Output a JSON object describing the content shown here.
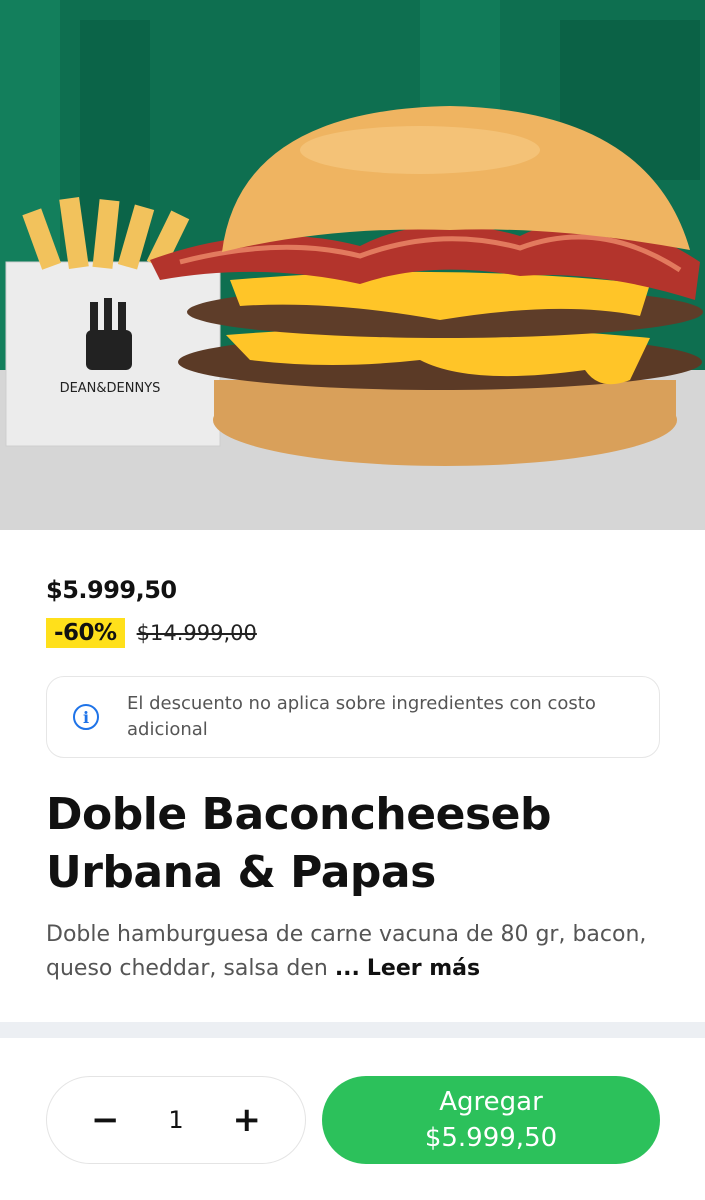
{
  "hero": {
    "brand_text": "DEAN&DENNYS",
    "image_description": "burger-and-fries-photo"
  },
  "product": {
    "price": "$5.999,50",
    "discount": "-60%",
    "old_price": "$14.999,00",
    "notice": "El descuento no aplica sobre ingredientes con costo adicional",
    "title": "Doble Baconcheeseb Urbana & Papas",
    "description": "Doble hamburguesa de carne vacuna de 80 gr, bacon, queso cheddar, salsa den",
    "ellipsis": "...",
    "read_more": "Leer más"
  },
  "cart": {
    "quantity": "1",
    "minus_label": "−",
    "plus_label": "+",
    "add_label": "Agregar",
    "add_price": "$5.999,50"
  },
  "colors": {
    "accent_green": "#2cc15b",
    "discount_yellow": "#ffe01b",
    "info_blue": "#1e73e8"
  }
}
